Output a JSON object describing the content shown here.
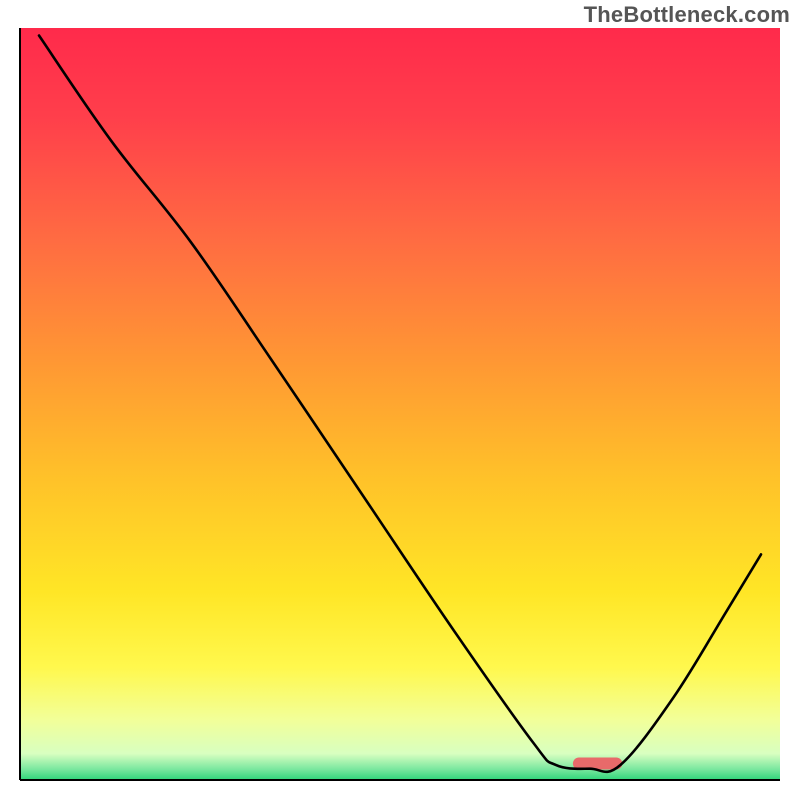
{
  "watermark": "TheBottleneck.com",
  "chart_data": {
    "type": "line",
    "title": "",
    "xlabel": "",
    "ylabel": "",
    "xlim": [
      0,
      100
    ],
    "ylim": [
      0,
      100
    ],
    "background_gradient": {
      "stops": [
        {
          "offset": 0.0,
          "color": "#ff2a4b"
        },
        {
          "offset": 0.12,
          "color": "#ff3f4b"
        },
        {
          "offset": 0.28,
          "color": "#ff6b42"
        },
        {
          "offset": 0.45,
          "color": "#ff9933"
        },
        {
          "offset": 0.6,
          "color": "#ffc229"
        },
        {
          "offset": 0.75,
          "color": "#ffe626"
        },
        {
          "offset": 0.85,
          "color": "#fff84d"
        },
        {
          "offset": 0.92,
          "color": "#f2ff99"
        },
        {
          "offset": 0.965,
          "color": "#d8ffc0"
        },
        {
          "offset": 0.985,
          "color": "#7de8a0"
        },
        {
          "offset": 1.0,
          "color": "#2fd57a"
        }
      ]
    },
    "series": [
      {
        "name": "bottleneck-curve",
        "color": "#000000",
        "width": 2.6,
        "points": [
          {
            "x": 2.5,
            "y": 99.0
          },
          {
            "x": 12.0,
            "y": 85.0
          },
          {
            "x": 22.5,
            "y": 71.5
          },
          {
            "x": 33.0,
            "y": 56.0
          },
          {
            "x": 45.0,
            "y": 38.0
          },
          {
            "x": 57.0,
            "y": 20.0
          },
          {
            "x": 67.5,
            "y": 5.0
          },
          {
            "x": 70.5,
            "y": 2.0
          },
          {
            "x": 75.0,
            "y": 1.5
          },
          {
            "x": 79.0,
            "y": 2.0
          },
          {
            "x": 86.0,
            "y": 11.0
          },
          {
            "x": 93.0,
            "y": 22.5
          },
          {
            "x": 97.5,
            "y": 30.0
          }
        ]
      }
    ],
    "marker": {
      "name": "optimal-zone",
      "color": "#e86a6a",
      "x_center": 76.0,
      "y": 2.2,
      "width_pct": 6.5,
      "height_pct": 1.6
    }
  }
}
